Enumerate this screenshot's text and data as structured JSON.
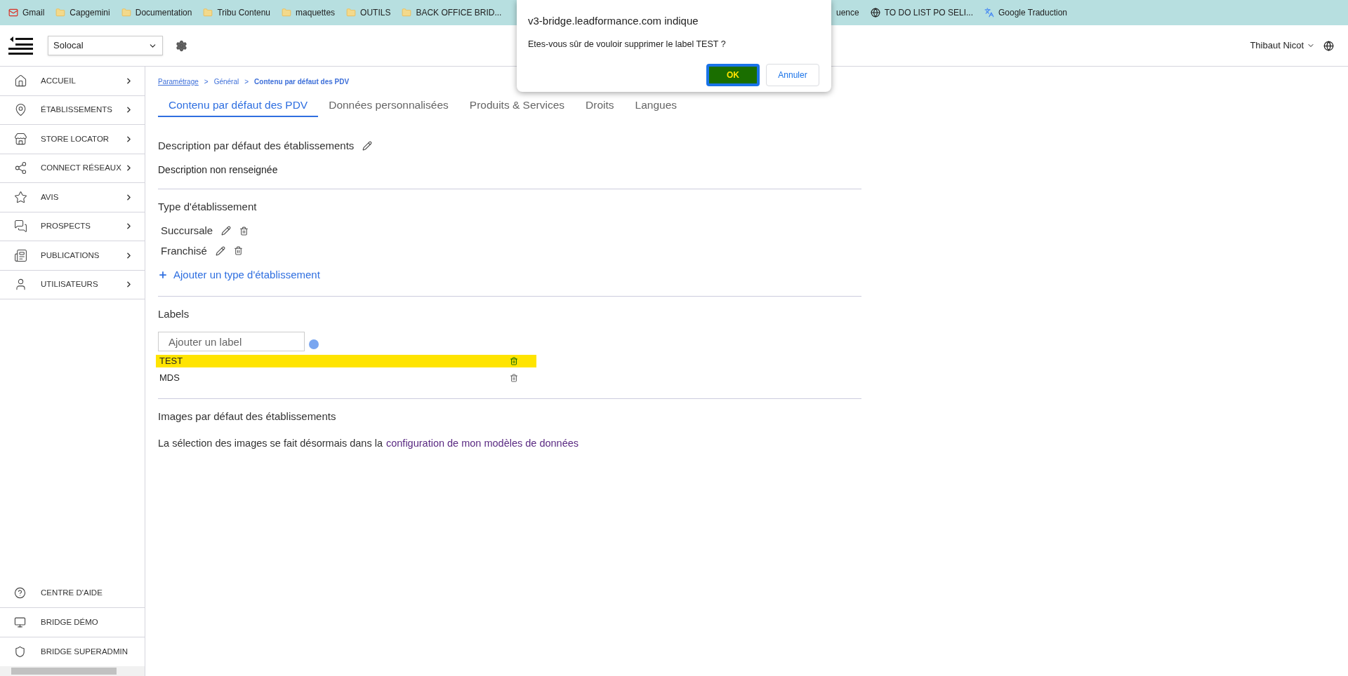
{
  "bookmarks": [
    {
      "label": "Gmail",
      "kind": "mail"
    },
    {
      "label": "Capgemini",
      "kind": "folder"
    },
    {
      "label": "Documentation",
      "kind": "folder"
    },
    {
      "label": "Tribu Contenu",
      "kind": "folder"
    },
    {
      "label": "maquettes",
      "kind": "folder"
    },
    {
      "label": "OUTILS",
      "kind": "folder"
    },
    {
      "label": "BACK OFFICE BRID...",
      "kind": "folder"
    }
  ],
  "bookmarks_right": [
    {
      "label": "uence",
      "kind": "hidden"
    },
    {
      "label": "TO DO LIST PO SELI...",
      "kind": "globe"
    },
    {
      "label": "Google Traduction",
      "kind": "translate"
    }
  ],
  "header": {
    "account_select": "Solocal",
    "user": "Thibaut Nicot"
  },
  "sidebar": {
    "items": [
      {
        "label": "ACCUEIL"
      },
      {
        "label": "ÉTABLISSEMENTS"
      },
      {
        "label": "STORE LOCATOR"
      },
      {
        "label": "CONNECT RÉSEAUX"
      },
      {
        "label": "AVIS"
      },
      {
        "label": "PROSPECTS"
      },
      {
        "label": "PUBLICATIONS"
      },
      {
        "label": "UTILISATEURS"
      }
    ],
    "bottom_items": [
      {
        "label": "CENTRE D'AIDE"
      },
      {
        "label": "BRIDGE DÉMO"
      },
      {
        "label": "BRIDGE SUPERADMIN"
      }
    ]
  },
  "breadcrumb": [
    {
      "label": "Paramétrage",
      "link": true
    },
    {
      "label": ">",
      "link": false
    },
    {
      "label": "Général",
      "link": false
    },
    {
      "label": ">",
      "link": false
    },
    {
      "label": "Contenu par défaut des PDV",
      "link": false
    }
  ],
  "tabs": [
    {
      "label": "Contenu par défaut des PDV",
      "selected": true
    },
    {
      "label": "Données personnalisées",
      "selected": false
    },
    {
      "label": "Produits & Services",
      "selected": false
    },
    {
      "label": "Droits",
      "selected": false
    },
    {
      "label": "Langues",
      "selected": false
    }
  ],
  "description": {
    "title": "Description par défaut des établissements",
    "value": "Description non renseignée"
  },
  "types": {
    "title": "Type d'établissement",
    "items": [
      "Succursale",
      "Franchisé"
    ],
    "add_link": "Ajouter un type d'établissement"
  },
  "labels": {
    "title": "Labels",
    "placeholder": "Ajouter un label",
    "items": [
      {
        "label": "TEST",
        "selected": true
      },
      {
        "label": "MDS",
        "selected": false
      }
    ]
  },
  "images": {
    "title": "Images par défaut des établissements",
    "text": "La sélection des images se fait désormais dans la",
    "link": "configuration de mon modèles de données"
  },
  "dialog": {
    "title": "v3-bridge.leadformance.com indique",
    "message": "Etes-vous sûr de vouloir supprimer le label TEST ?",
    "buttons": [
      {
        "label": "OK",
        "selected": true
      },
      {
        "label": "Annuler",
        "selected": false
      }
    ]
  }
}
